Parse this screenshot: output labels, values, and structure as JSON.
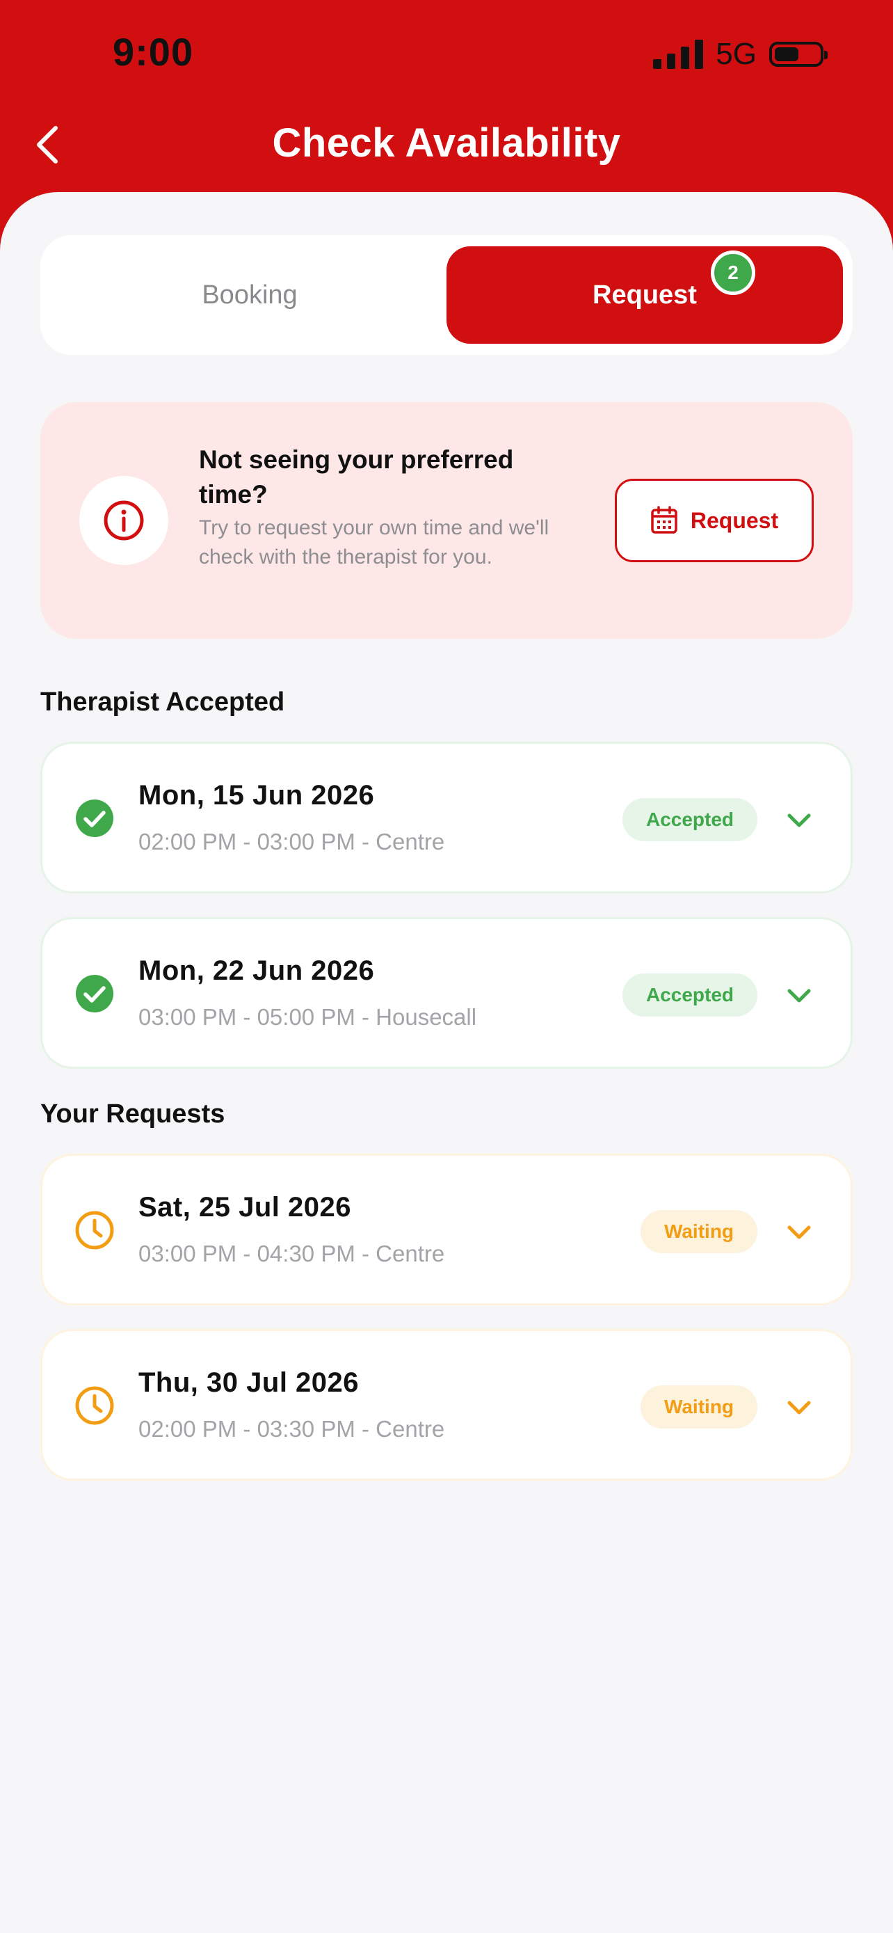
{
  "status_bar": {
    "time": "9:00",
    "network": "5G",
    "battery_level": 0.55
  },
  "header": {
    "title": "Check Availability"
  },
  "tabs": [
    {
      "label": "Booking",
      "active": false
    },
    {
      "label": "Request",
      "active": true,
      "badge": "2"
    }
  ],
  "info_card": {
    "title": "Not seeing your preferred time?",
    "subtitle": "Try to request your own time and we'll check with the therapist for you.",
    "button_label": "Request",
    "icon": "info-icon"
  },
  "sections": {
    "accepted_title": "Therapist Accepted",
    "requests_title": "Your Requests"
  },
  "accepted": [
    {
      "date": "Mon, 15 Jun 2026",
      "time": "02:00 PM - 03:00 PM - Centre",
      "status": "Accepted"
    },
    {
      "date": "Mon, 22 Jun 2026",
      "time": "03:00 PM - 05:00 PM - Housecall",
      "status": "Accepted"
    }
  ],
  "requests": [
    {
      "date": "Sat, 25 Jul 2026",
      "time": "03:00 PM - 04:30 PM - Centre",
      "status": "Waiting"
    },
    {
      "date": "Thu, 30 Jul 2026",
      "time": "02:00 PM - 03:30 PM - Centre",
      "status": "Waiting"
    }
  ],
  "colors": {
    "brand_red": "#d20f10",
    "accepted_green": "#3fa84b",
    "waiting_orange": "#f29d14",
    "info_card_bg": "#fde8e7"
  }
}
